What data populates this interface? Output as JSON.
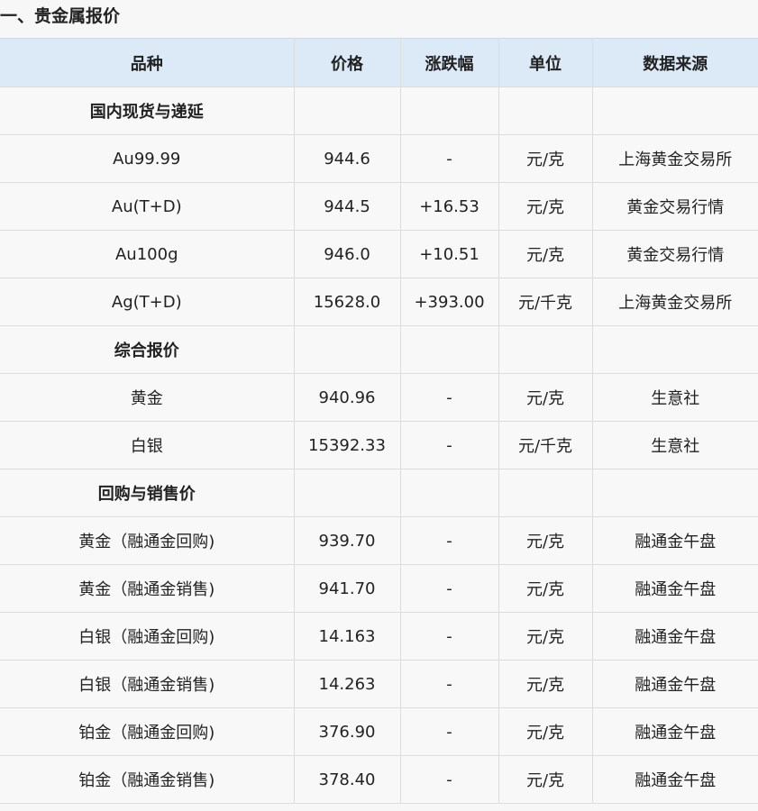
{
  "section": {
    "title": "一、贵金属报价"
  },
  "table": {
    "headers": [
      "品种",
      "价格",
      "涨跌幅",
      "单位",
      "数据来源"
    ],
    "groups": [
      {
        "label": "国内现货与递延",
        "rows": [
          [
            "Au99.99",
            "944.6",
            "-",
            "元/克",
            "上海黄金交易所"
          ],
          [
            "Au(T+D)",
            "944.5",
            "+16.53",
            "元/克",
            "黄金交易行情"
          ],
          [
            "Au100g",
            "946.0",
            "+10.51",
            "元/克",
            "黄金交易行情"
          ],
          [
            "Ag(T+D)",
            "15628.0",
            "+393.00",
            "元/千克",
            "上海黄金交易所"
          ]
        ]
      },
      {
        "label": "综合报价",
        "rows": [
          [
            "黄金",
            "940.96",
            "-",
            "元/克",
            "生意社"
          ],
          [
            "白银",
            "15392.33",
            "-",
            "元/千克",
            "生意社"
          ]
        ]
      },
      {
        "label": "回购与销售价",
        "rows": [
          [
            "黄金（融通金回购)",
            "939.70",
            "-",
            "元/克",
            "融通金午盘"
          ],
          [
            "黄金（融通金销售)",
            "941.70",
            "-",
            "元/克",
            "融通金午盘"
          ],
          [
            "白银（融通金回购)",
            "14.163",
            "-",
            "元/克",
            "融通金午盘"
          ],
          [
            "白银（融通金销售)",
            "14.263",
            "-",
            "元/克",
            "融通金午盘"
          ],
          [
            "铂金（融通金回购)",
            "376.90",
            "-",
            "元/克",
            "融通金午盘"
          ],
          [
            "铂金（融通金销售)",
            "378.40",
            "-",
            "元/克",
            "融通金午盘"
          ]
        ]
      }
    ]
  }
}
